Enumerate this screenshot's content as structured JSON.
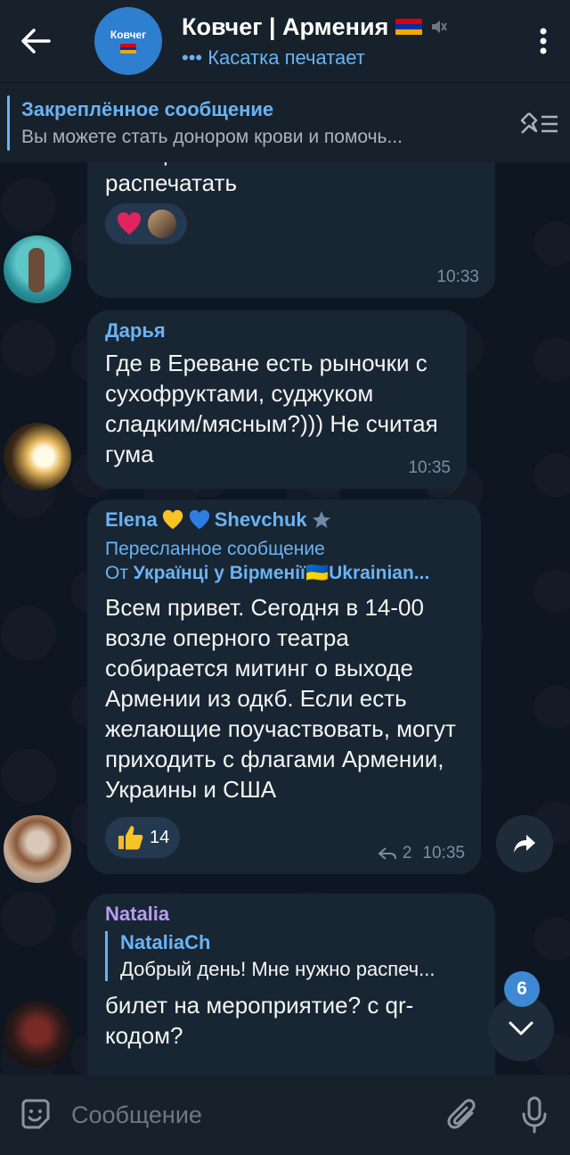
{
  "header": {
    "back_icon": "arrow-left-icon",
    "avatar_text": "Ковчег",
    "title": "Ковчег | Армения",
    "typing_dots": "•••",
    "status": "Касатка печатает",
    "menu_icon": "more-vert-icon",
    "flag_colors": [
      "#d90012",
      "#0033a0",
      "#f2a800"
    ]
  },
  "pinned": {
    "title": "Закреплённое сообщение",
    "text": "Вы можете стать донором крови и помочь...",
    "icon": "unpin-list-icon"
  },
  "messages": [
    {
      "partial_text": "и в офисах моб.связи распечатать",
      "reactions": [
        {
          "emoji": "heart",
          "color": "#e0245e"
        }
      ],
      "time": "10:33"
    },
    {
      "author": "Дарья",
      "text": "Где в Ереване есть рыночки с сухофруктами, суджуком сладким/мясным?))) Не считая гума",
      "time": "10:35"
    },
    {
      "author": "Elena",
      "author_suffix": "Shevchuk",
      "forward_label": "Пересланное сообщение",
      "forward_from_prefix": "От",
      "forward_from": "Українці у Вірменії🇺🇦Ukrainian...",
      "text": "Всем привет. Сегодня в 14-00 возле оперного театра собирается митинг о выходе Армении из одкб. Если есть желающие поучаствовать, могут приходить с флагами Армении, Украины и США",
      "reaction_count": "14",
      "replies": "2",
      "time": "10:35"
    },
    {
      "author": "Natalia",
      "reply_author": "NataliaCh",
      "reply_text": "Добрый день! Мне нужно распеч...",
      "text": "билет на мероприятие? с qr-кодом?"
    }
  ],
  "unread_count": "6",
  "input": {
    "placeholder": "Сообщение"
  },
  "colors": {
    "accent": "#6ab3f3",
    "bubble": "#182533",
    "background": "#0e1621",
    "bar": "#17212b"
  }
}
